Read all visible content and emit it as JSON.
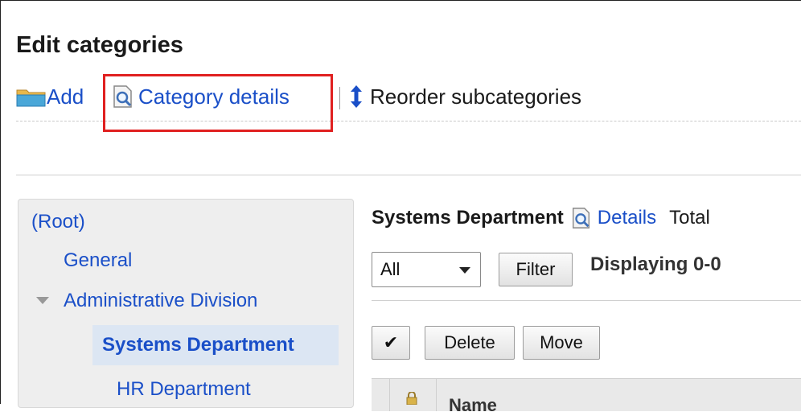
{
  "page": {
    "title": "Edit categories"
  },
  "toolbar": {
    "add_label": "Add",
    "details_label": "Category details",
    "reorder_label": "Reorder subcategories"
  },
  "sidebar": {
    "root_label": "(Root)",
    "items": [
      {
        "label": "General"
      },
      {
        "label": "Administrative Division"
      },
      {
        "label": "Systems Department"
      },
      {
        "label": "HR Department"
      }
    ]
  },
  "content": {
    "category_name": "Systems Department",
    "details_link": "Details",
    "total_label": "Total",
    "filter_select": "All",
    "filter_button": "Filter",
    "displaying": "Displaying 0-0",
    "check_button": "✔",
    "delete_button": "Delete",
    "move_button": "Move",
    "column_name": "Name"
  },
  "colors": {
    "link": "#1a4fc8",
    "highlight_border": "#e02020",
    "selected_bg": "#dce6f3"
  },
  "icons": [
    "folder-add-icon",
    "document-search-icon",
    "reorder-arrows-icon",
    "chevron-down-icon",
    "lock-icon"
  ]
}
